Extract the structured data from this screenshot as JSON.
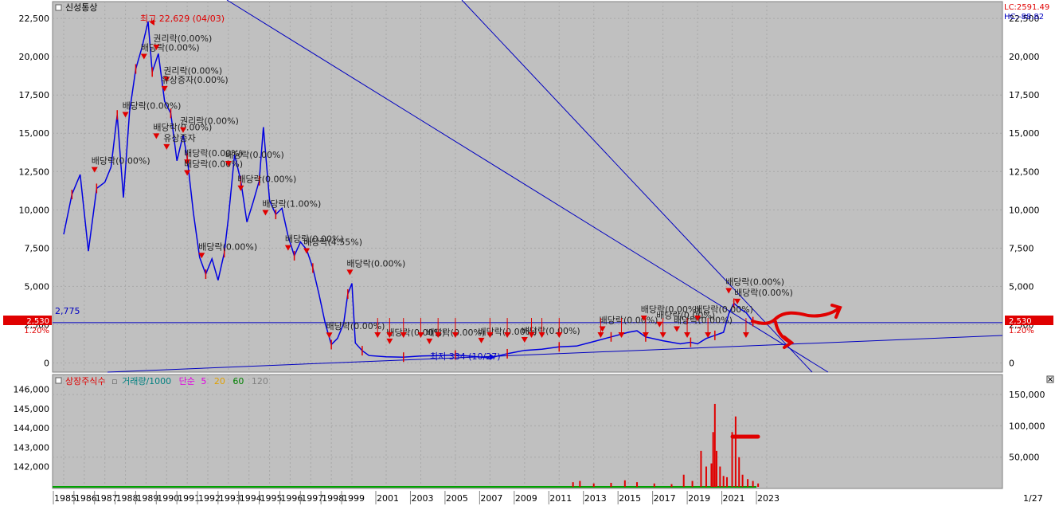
{
  "chart_data": [
    {
      "type": "line",
      "title": "신성통상",
      "high_marker": "최고 22,629 (04/03)",
      "low_marker": "최저 334 (10/27)",
      "reference_line_label": "2,775",
      "current_price_label": "2,530",
      "current_pct_label": "1.20%",
      "lc_label": "LC:2591.49",
      "hc_label": "HC:-88.82",
      "y_ticks": [
        0,
        2500,
        5000,
        7500,
        10000,
        12500,
        15000,
        17500,
        20000,
        22500
      ],
      "y_tick_labels": [
        "0",
        "2,500",
        "5,000",
        "7,500",
        "10,000",
        "12,500",
        "15,000",
        "17,500",
        "20,000",
        "22,500"
      ],
      "ylim": [
        -600,
        23600
      ],
      "x_labels": [
        "1985",
        "1986",
        "1987",
        "1988",
        "1989",
        "1990",
        "1991",
        "1992",
        "1993",
        "1994",
        "1995",
        "1996",
        "1997",
        "1998",
        "1999",
        "2001",
        "2003",
        "2005",
        "2007",
        "2009",
        "2011",
        "2013",
        "2015",
        "2017",
        "2019",
        "2021",
        "2023"
      ],
      "end_date_label": "1/27",
      "series": [
        {
          "values": [
            [
              1985.0,
              8400
            ],
            [
              1985.4,
              11000
            ],
            [
              1985.8,
              12300
            ],
            [
              1986.2,
              7300
            ],
            [
              1986.6,
              11400
            ],
            [
              1987.0,
              11800
            ],
            [
              1987.3,
              12800
            ],
            [
              1987.6,
              16200
            ],
            [
              1987.9,
              10800
            ],
            [
              1988.2,
              16400
            ],
            [
              1988.5,
              19200
            ],
            [
              1988.8,
              20600
            ],
            [
              1989.1,
              22300
            ],
            [
              1989.3,
              19000
            ],
            [
              1989.6,
              20200
            ],
            [
              1989.9,
              17100
            ],
            [
              1990.2,
              16300
            ],
            [
              1990.5,
              13200
            ],
            [
              1990.8,
              14900
            ],
            [
              1991.0,
              13400
            ],
            [
              1991.3,
              9800
            ],
            [
              1991.6,
              6900
            ],
            [
              1991.9,
              5800
            ],
            [
              1992.2,
              6800
            ],
            [
              1992.5,
              5400
            ],
            [
              1992.8,
              7200
            ],
            [
              1993.0,
              9500
            ],
            [
              1993.3,
              13600
            ],
            [
              1993.6,
              11900
            ],
            [
              1993.9,
              9200
            ],
            [
              1994.2,
              10500
            ],
            [
              1994.5,
              11900
            ],
            [
              1994.7,
              15400
            ],
            [
              1995.0,
              10600
            ],
            [
              1995.3,
              9700
            ],
            [
              1995.6,
              10100
            ],
            [
              1995.9,
              8300
            ],
            [
              1996.2,
              7000
            ],
            [
              1996.5,
              7900
            ],
            [
              1996.8,
              7400
            ],
            [
              1997.1,
              6200
            ],
            [
              1997.4,
              4500
            ],
            [
              1997.7,
              2600
            ],
            [
              1998.0,
              1200
            ],
            [
              1998.3,
              1600
            ],
            [
              1998.6,
              2600
            ],
            [
              1998.8,
              4500
            ],
            [
              1999.0,
              5200
            ],
            [
              1999.2,
              1300
            ],
            [
              1999.6,
              800
            ],
            [
              2000.0,
              480
            ],
            [
              2001.0,
              400
            ],
            [
              2002.0,
              380
            ],
            [
              2003.0,
              450
            ],
            [
              2004.0,
              480
            ],
            [
              2005.0,
              520
            ],
            [
              2006.0,
              430
            ],
            [
              2007.0,
              334
            ],
            [
              2008.0,
              600
            ],
            [
              2009.0,
              820
            ],
            [
              2010.0,
              900
            ],
            [
              2011.0,
              1050
            ],
            [
              2012.0,
              1100
            ],
            [
              2013.0,
              1400
            ],
            [
              2014.0,
              1700
            ],
            [
              2015.0,
              2000
            ],
            [
              2015.5,
              2100
            ],
            [
              2016.0,
              1700
            ],
            [
              2017.0,
              1450
            ],
            [
              2018.0,
              1250
            ],
            [
              2018.6,
              1350
            ],
            [
              2019.0,
              1250
            ],
            [
              2019.5,
              1600
            ],
            [
              2020.0,
              1800
            ],
            [
              2020.5,
              2000
            ],
            [
              2020.8,
              3200
            ],
            [
              2021.1,
              3900
            ],
            [
              2021.5,
              3500
            ],
            [
              2021.8,
              3300
            ],
            [
              2022.2,
              2700
            ],
            [
              2022.6,
              2530
            ]
          ]
        }
      ],
      "annotations": [
        {
          "text": "배당락(0.00%)",
          "x": 1986.5,
          "y": 13000
        },
        {
          "text": "배당락(0.00%)",
          "x": 1988.0,
          "y": 16600
        },
        {
          "text": "배당락(0.00%)",
          "x": 1988.9,
          "y": 20400
        },
        {
          "text": "권리락(0.00%)",
          "x": 1989.5,
          "y": 21000
        },
        {
          "text": "권리락(0.00%)",
          "x": 1990.0,
          "y": 18900
        },
        {
          "text": "유상증자(0.00%)",
          "x": 1989.9,
          "y": 18300
        },
        {
          "text": "배당락(0.00%)",
          "x": 1989.5,
          "y": 15200
        },
        {
          "text": "권리락(0.00%)",
          "x": 1990.8,
          "y": 15600
        },
        {
          "text": "유상증자",
          "x": 1990.0,
          "y": 14500
        },
        {
          "text": "배당락(0.00%)",
          "x": 1991.0,
          "y": 13500
        },
        {
          "text": "배당락(0.00%)",
          "x": 1991.0,
          "y": 12800
        },
        {
          "text": "배당락(0.00%)",
          "x": 1993.0,
          "y": 13400
        },
        {
          "text": "배당락(0.00%)",
          "x": 1993.6,
          "y": 11800
        },
        {
          "text": "배당락(1.00%)",
          "x": 1994.8,
          "y": 10200
        },
        {
          "text": "배당락(0.00%)",
          "x": 1991.7,
          "y": 7400
        },
        {
          "text": "배당락(0.00%)",
          "x": 1995.9,
          "y": 7900
        },
        {
          "text": "배당락(4.55%)",
          "x": 1996.8,
          "y": 7700
        },
        {
          "text": "배당락(0.00%)",
          "x": 1998.9,
          "y": 6300
        },
        {
          "text": "배당락(0.00%)",
          "x": 1997.9,
          "y": 2200
        },
        {
          "text": "배당락(0.00%)",
          "x": 2001.2,
          "y": 1800
        },
        {
          "text": "배당락(0.00%)",
          "x": 2003.5,
          "y": 1800
        },
        {
          "text": "배당락(0.00%)",
          "x": 2006.5,
          "y": 1850
        },
        {
          "text": "배당락(0.00%)",
          "x": 2009.0,
          "y": 1900
        },
        {
          "text": "배당락(0.00%)",
          "x": 2013.5,
          "y": 2600
        },
        {
          "text": "배당락(0.00%)",
          "x": 2015.9,
          "y": 3300
        },
        {
          "text": "배당락(0.00%)",
          "x": 2016.8,
          "y": 2900
        },
        {
          "text": "배당락(0.00%)",
          "x": 2017.8,
          "y": 2600
        },
        {
          "text": "배당락(0.00%)",
          "x": 2019.0,
          "y": 3300
        },
        {
          "text": "배당락(0.00%)",
          "x": 2020.8,
          "y": 5100
        },
        {
          "text": "배당락(0.00%)",
          "x": 2021.3,
          "y": 4400
        }
      ]
    },
    {
      "type": "bar",
      "legend": [
        {
          "name": "상장주식수",
          "color": "#e00000"
        },
        {
          "name": "거래량/1000",
          "color": "#008080"
        },
        {
          "name": "단순",
          "color": "#e000e0"
        },
        {
          "name": "5",
          "color": "#e000e0"
        },
        {
          "name": "20",
          "color": "#e0a000"
        },
        {
          "name": "60",
          "color": "#008000"
        },
        {
          "name": "120",
          "color": "#808080"
        }
      ],
      "left_y_ticks": [
        142000,
        143000,
        144000,
        145000,
        146000
      ],
      "left_y_tick_labels": [
        "142,000",
        "143,000",
        "144,000",
        "145,000",
        "146,000"
      ],
      "right_y_ticks": [
        50000,
        100000,
        150000
      ],
      "right_y_tick_labels": [
        "50,000",
        "100,000",
        "150,000"
      ],
      "ylim": [
        0,
        182000
      ],
      "volume": [
        [
          2011.8,
          10000
        ],
        [
          2012.2,
          12000
        ],
        [
          2013.0,
          8000
        ],
        [
          2014.0,
          9000
        ],
        [
          2014.8,
          13000
        ],
        [
          2015.5,
          10000
        ],
        [
          2016.5,
          8000
        ],
        [
          2017.5,
          7000
        ],
        [
          2018.2,
          22000
        ],
        [
          2018.7,
          12000
        ],
        [
          2019.2,
          60000
        ],
        [
          2019.5,
          35000
        ],
        [
          2019.8,
          40000
        ],
        [
          2019.9,
          90000
        ],
        [
          2020.0,
          135000
        ],
        [
          2020.1,
          60000
        ],
        [
          2020.3,
          35000
        ],
        [
          2020.5,
          20000
        ],
        [
          2020.7,
          18000
        ],
        [
          2021.0,
          90000
        ],
        [
          2021.2,
          115000
        ],
        [
          2021.4,
          50000
        ],
        [
          2021.6,
          22000
        ],
        [
          2021.9,
          15000
        ],
        [
          2022.2,
          12000
        ],
        [
          2022.5,
          8000
        ]
      ]
    }
  ]
}
